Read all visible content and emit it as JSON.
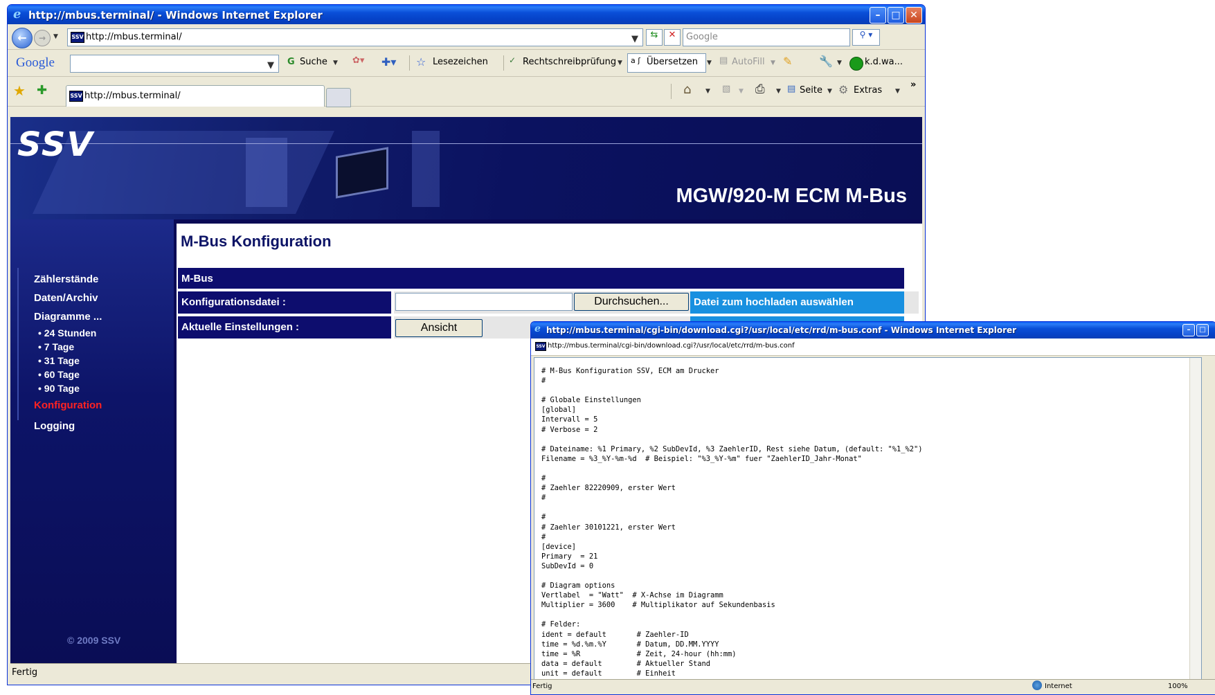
{
  "main_window": {
    "title": "http://mbus.terminal/ - Windows Internet Explorer",
    "address": "http://mbus.terminal/",
    "search_placeholder": "Google",
    "google_toolbar": {
      "logo": "Google",
      "suche": "Suche",
      "lesezeichen": "Lesezeichen",
      "rechtschreib": "Rechtschreibprüfung",
      "uebersetzen": "Übersetzen",
      "autofill": "AutoFill",
      "user": "k.d.wa..."
    },
    "tab_label": "http://mbus.terminal/",
    "command_bar": {
      "seite": "Seite",
      "extras": "Extras"
    },
    "status": "Fertig",
    "colors": {
      "titlebar": "#0a4fd8",
      "page_bg": "#0a0a55",
      "cell_dark": "#0d0d6e",
      "cell_light": "#1890e0"
    }
  },
  "site": {
    "logo": "SSV",
    "banner_title": "MGW/920-M ECM M-Bus",
    "nav": [
      {
        "label": "Zählerstände"
      },
      {
        "label": "Daten/Archiv"
      },
      {
        "label": "Diagramme ..."
      },
      {
        "label": "Konfiguration"
      },
      {
        "label": "Logging"
      }
    ],
    "subnav": [
      "• 24 Stunden",
      "• 7 Tage",
      "• 31 Tage",
      "• 60 Tage",
      "• 90 Tage"
    ],
    "copyright": "© 2009 SSV",
    "content": {
      "title": "M-Bus Konfiguration",
      "section_header": "M-Bus",
      "row1_label": "Konfigurationsdatei :",
      "browse_button": "Durchsuchen...",
      "row1_hint": "Datei zum hochladen auswählen",
      "row2_label": "Aktuelle Einstellungen :",
      "view_button": "Ansicht"
    }
  },
  "popup_window": {
    "title": "http://mbus.terminal/cgi-bin/download.cgi?/usr/local/etc/rrd/m-bus.conf - Windows Internet Explorer",
    "address": "http://mbus.terminal/cgi-bin/download.cgi?/usr/local/etc/rrd/m-bus.conf",
    "file_lines": [
      "# M-Bus Konfiguration SSV, ECM am Drucker",
      "#",
      "",
      "# Globale Einstellungen",
      "[global]",
      "Intervall = 5",
      "# Verbose = 2",
      "",
      "# Dateiname: %1 Primary, %2 SubDevId, %3 ZaehlerID, Rest siehe Datum, (default: \"%1_%2\")",
      "Filename = %3_%Y-%m-%d  # Beispiel: \"%3_%Y-%m\" fuer \"ZaehlerID_Jahr-Monat\"",
      "",
      "#",
      "# Zaehler 82220909, erster Wert",
      "#",
      "",
      "#",
      "# Zaehler 30101221, erster Wert",
      "#",
      "[device]",
      "Primary  = 21",
      "SubDevId = 0",
      "",
      "# Diagram options",
      "Vertlabel  = \"Watt\"  # X-Achse im Diagramm",
      "Multiplier = 3600    # Multiplikator auf Sekundenbasis",
      "",
      "# Felder:",
      "ident = default       # Zaehler-ID",
      "time = %d.%m.%Y       # Datum, DD.MM.YYYY",
      "time = %R             # Zeit, 24-hour (hh:mm)",
      "data = default        # Aktueller Stand",
      "unit = default        # Einheit"
    ],
    "status": "Fertig",
    "zone": "Internet",
    "zoom": "100%"
  }
}
